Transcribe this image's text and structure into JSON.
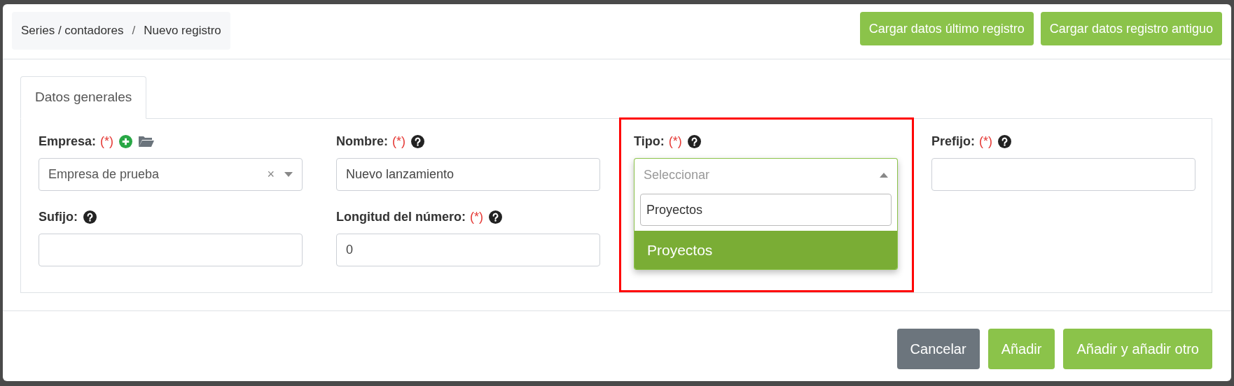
{
  "breadcrumb": {
    "items": [
      "Series / contadores",
      "Nuevo registro"
    ],
    "separator": "/"
  },
  "header_buttons": [
    "Cargar datos último registro",
    "Cargar datos registro antiguo"
  ],
  "tabs": [
    {
      "label": "Datos generales",
      "selected": true
    }
  ],
  "fields": [
    {
      "kind": "select",
      "label": "Empresa:",
      "required_mark": "(*)",
      "help": false,
      "shortcuts": true,
      "value": "Empresa de prueba",
      "clear": "×"
    },
    {
      "kind": "text",
      "label": "Nombre:",
      "required_mark": "(*)",
      "help": true,
      "value": "Nuevo lanzamiento"
    },
    {
      "kind": "dropdown",
      "label": "Tipo:",
      "required_mark": "(*)",
      "help": true,
      "annotated": true,
      "placeholder": "Seleccionar",
      "search": "Proyectos",
      "options": [
        {
          "label": "Proyectos",
          "highlighted": true
        }
      ]
    },
    {
      "kind": "text",
      "label": "Prefijo:",
      "required_mark": "(*)",
      "help": true
    },
    {
      "kind": "text",
      "label": "Sufijo:",
      "help": true
    },
    {
      "kind": "text",
      "label": "Longitud del número:",
      "required_mark": "(*)",
      "help": true,
      "value": "0"
    }
  ],
  "footer_buttons": [
    {
      "kind": "secondary",
      "label": "Cancelar"
    },
    {
      "kind": "primary",
      "label": "Añadir"
    },
    {
      "kind": "primary",
      "label": "Añadir y añadir otro"
    }
  ]
}
